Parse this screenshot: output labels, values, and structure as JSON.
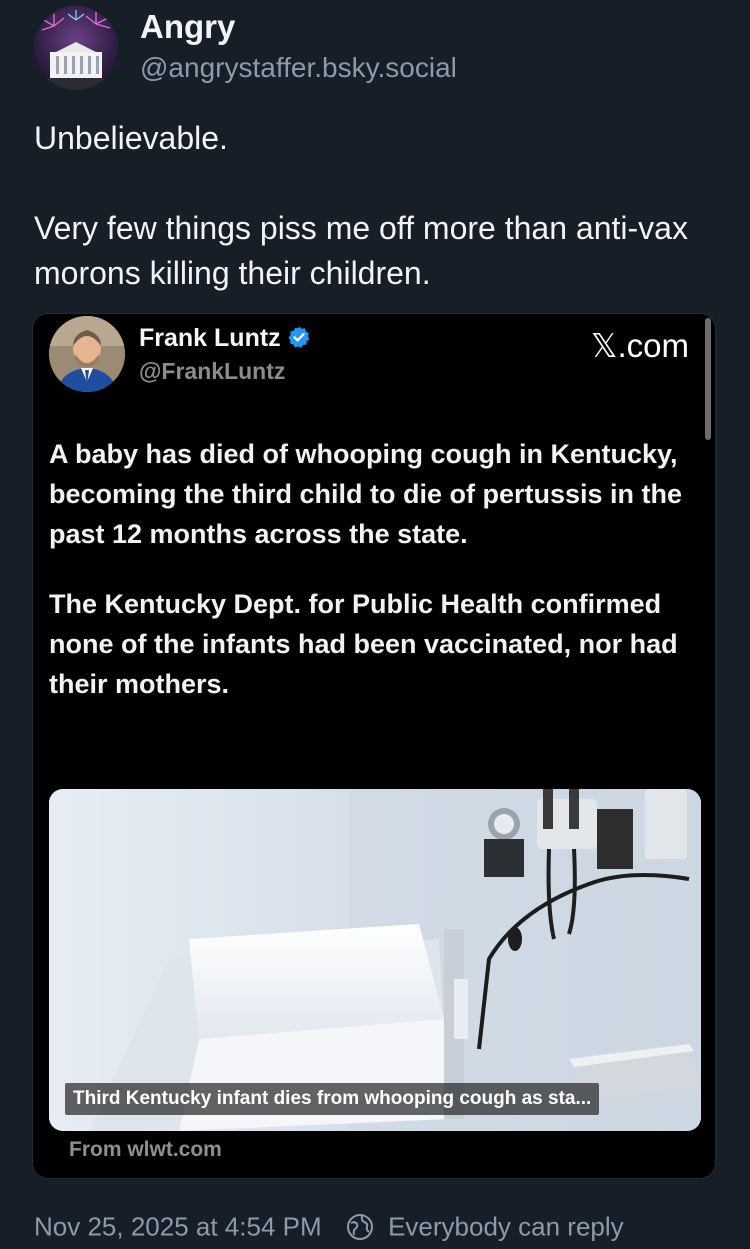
{
  "post": {
    "author_name": "Angry",
    "author_handle": "@angrystaffer.bsky.social",
    "text_paragraphs": [
      "Unbelievable.",
      "Very few things piss me off more than anti-vax morons killing their children."
    ],
    "timestamp": "Nov 25, 2025 at 4:54 PM",
    "reply_setting": "Everybody can reply"
  },
  "embed": {
    "author_name": "Frank Luntz",
    "author_handle": "@FrankLuntz",
    "source_label": "𝕏.com",
    "paragraphs": [
      "A baby has died of whooping cough in Kentucky, becoming the third child to die of pertussis in the past 12 months across the state.",
      "The Kentucky Dept. for Public Health confirmed none of the infants had been vaccinated, nor had their mothers."
    ],
    "link_card": {
      "title": "Third Kentucky infant dies from whooping cough as sta...",
      "domain": "From wlwt.com"
    }
  },
  "icons": {
    "verified": "verified-check-icon",
    "reply_setting": "globe-icon"
  },
  "colors": {
    "background": "#161e27",
    "embed_background": "#000000",
    "muted_text": "#8d9aac",
    "verified_blue": "#1d9bf0"
  }
}
